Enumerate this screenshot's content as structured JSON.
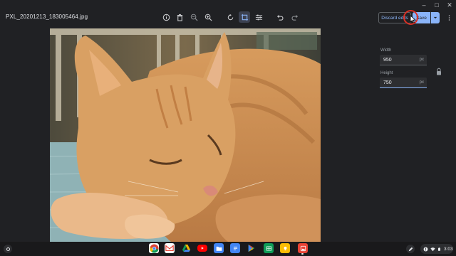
{
  "file": {
    "name": "PXL_20201213_183005464.jpg"
  },
  "toolbar": {
    "discard_label": "Discard edits",
    "save_label": "Save"
  },
  "resize": {
    "width_label": "Width",
    "width_value": "950",
    "width_unit": "px",
    "height_label": "Height",
    "height_value": "750",
    "height_unit": "px"
  },
  "shelf": {
    "apps": [
      "Chrome",
      "Gmail",
      "Google Drive",
      "YouTube",
      "Files",
      "Google Docs",
      "Play Store",
      "Google Sheets",
      "Google Keep",
      "Gallery"
    ],
    "time": "3:03"
  },
  "colors": {
    "accent": "#8ab4f8",
    "background": "#202124",
    "click_highlight": "#d93025"
  }
}
